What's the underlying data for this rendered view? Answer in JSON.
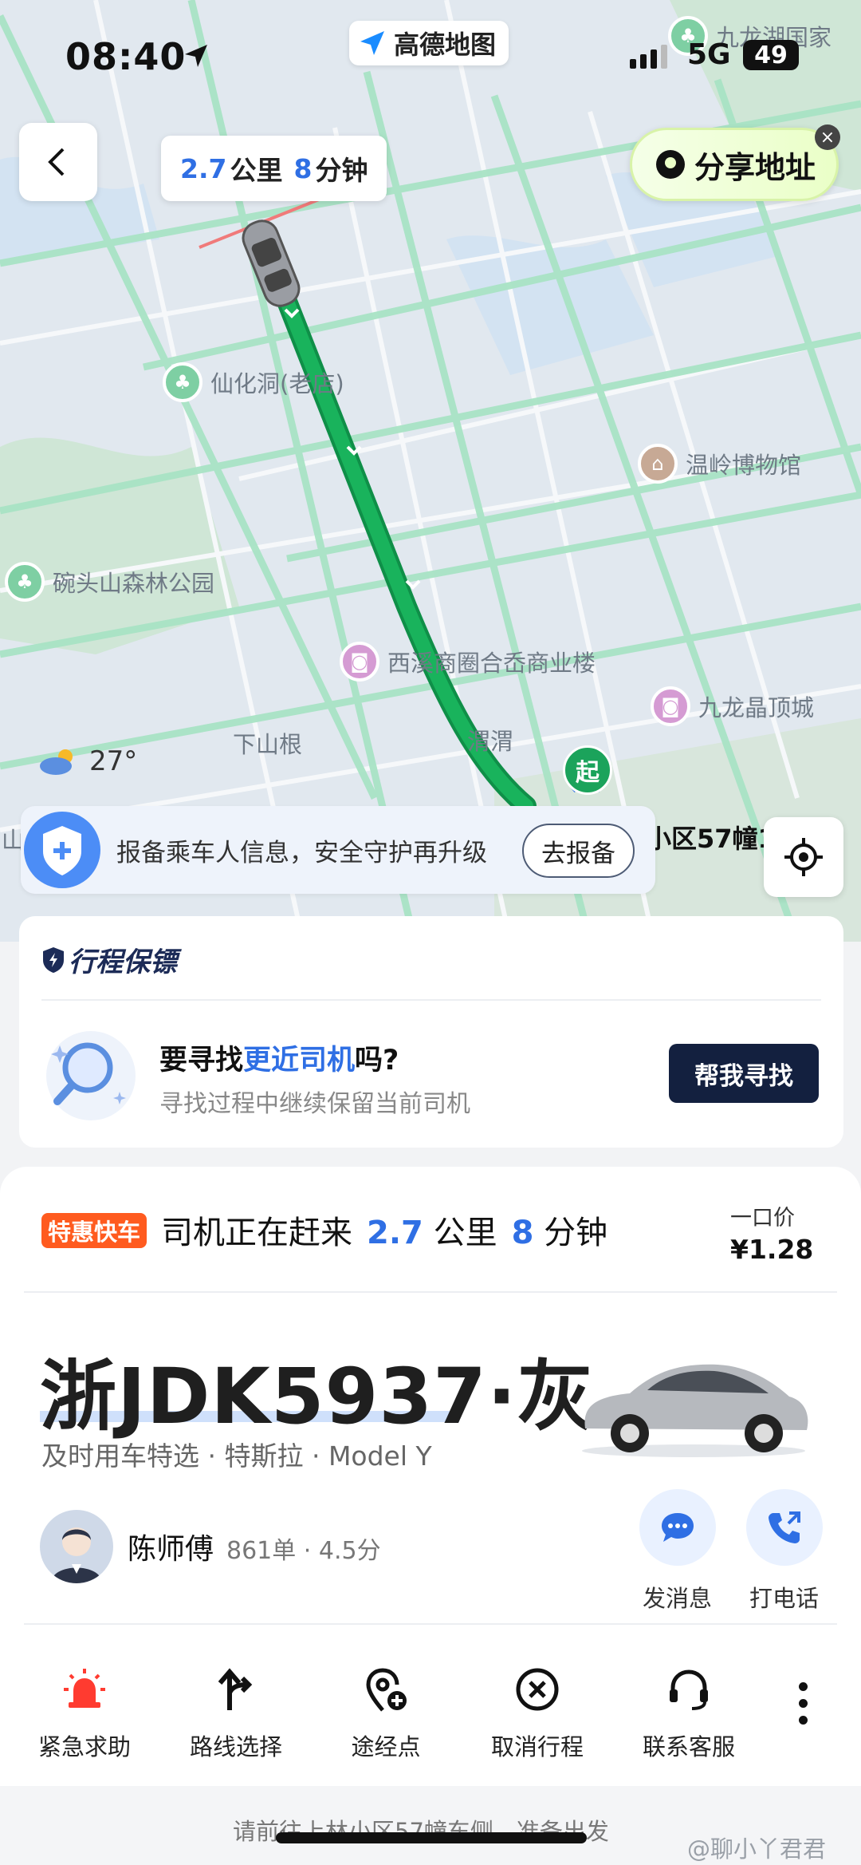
{
  "status_bar": {
    "time": "08:40",
    "network": "5G",
    "battery": "49"
  },
  "app_badge": "高德地图",
  "eta": {
    "distance": "2.7",
    "distance_unit": "公里",
    "minutes": "8",
    "minutes_unit": "分钟"
  },
  "share_button": "分享地址",
  "map_labels": {
    "jiulonghu": "九龙湖国家",
    "xianhuadong": "仙化洞(老店)",
    "wenling": "温岭博物馆",
    "wantou": "碗头山森林公园",
    "xixi": "西溪商圈合岙商业楼",
    "jiulongjing": "九龙晶顶城",
    "xiashangen": "下山根",
    "weiwei": "渭渭",
    "shan": "山",
    "start_pin": "起",
    "destination": "小区57幢1"
  },
  "weather": {
    "temp": "27°"
  },
  "report_banner": {
    "text": "报备乘车人信息，安全守护再升级",
    "button": "去报备"
  },
  "guard_card": {
    "title": "行程保镖",
    "question_prefix": "要寻找",
    "question_highlight": "更近司机",
    "question_suffix": "吗?",
    "subtitle": "寻找过程中继续保留当前司机",
    "button": "帮我寻找"
  },
  "trip": {
    "tag": "特惠快车",
    "status": "司机正在赶来",
    "distance": "2.7",
    "distance_unit": "公里",
    "minutes": "8",
    "minutes_unit": "分钟",
    "price_label": "一口价",
    "price": "¥1.28",
    "plate": "浙JDK5937·灰",
    "car_model": "及时用车特选 · 特斯拉 · Model Y",
    "driver_name": "陈师傅",
    "driver_stats": "861单 · 4.5分",
    "message_label": "发消息",
    "call_label": "打电话"
  },
  "actions": [
    {
      "label": "紧急求助",
      "icon": "alarm-icon"
    },
    {
      "label": "路线选择",
      "icon": "route-icon"
    },
    {
      "label": "途经点",
      "icon": "waypoint-icon"
    },
    {
      "label": "取消行程",
      "icon": "cancel-icon"
    },
    {
      "label": "联系客服",
      "icon": "headset-icon"
    }
  ],
  "bottom_hint": "请前往上林小区57幢东侧，准备出发",
  "watermark": "@聊小丫君君",
  "colors": {
    "route": "#19b35c",
    "accent_blue": "#2f6fe4",
    "tag_orange": "#ff5b1f",
    "dark_button": "#13203f"
  }
}
